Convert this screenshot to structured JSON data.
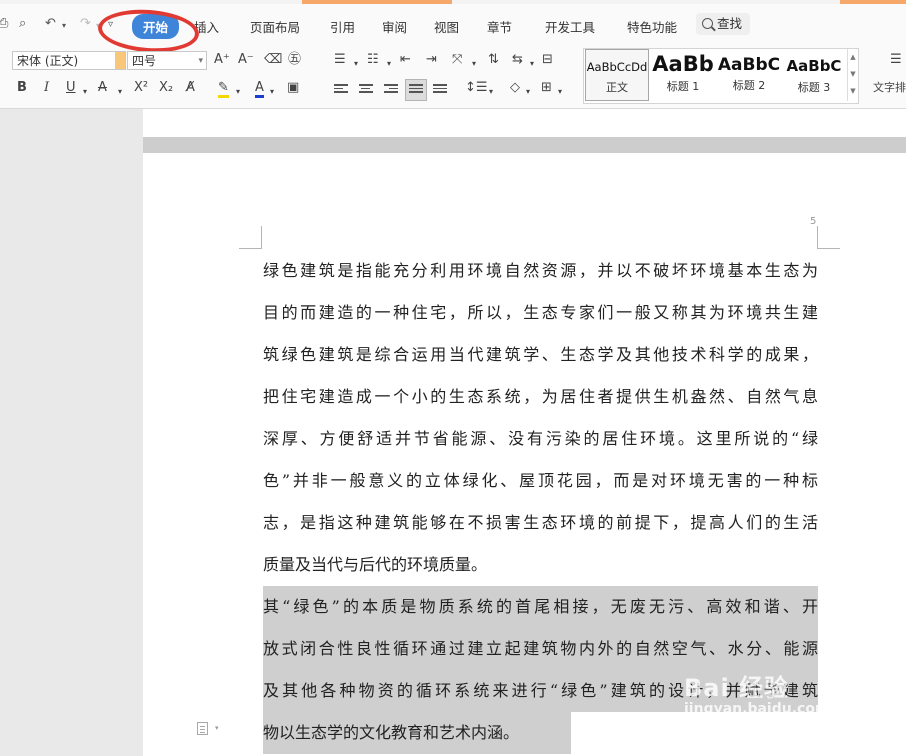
{
  "menubar": {
    "items": [
      "开始",
      "插入",
      "页面布局",
      "引用",
      "审阅",
      "视图",
      "章节",
      "开发工具",
      "特色功能"
    ],
    "active": "开始",
    "search_label": "查找"
  },
  "font": {
    "family_value": "宋体 (正文)",
    "size_value": "四号"
  },
  "styles": [
    {
      "sample": "AaBbCcDd",
      "label": "正文"
    },
    {
      "sample": "AaBb",
      "label": "标题 1"
    },
    {
      "sample": "AaBbC",
      "label": "标题 2"
    },
    {
      "sample": "AaBbC",
      "label": "标题 3"
    }
  ],
  "toolbar_extra_label": "文字排",
  "document": {
    "page_number": "5",
    "paragraphs": [
      {
        "highlighted": false,
        "lines": [
          "绿色建筑是指能充分利用环境自然资源，并以不破坏环境基本生态为",
          "目的而建造的一种住宅，所以，生态专家们一般又称其为环境共生建",
          "筑绿色建筑是综合运用当代建筑学、生态学及其他技术科学的成果，",
          "把住宅建造成一个小的生态系统，为居住者提供生机盎然、自然气息",
          "深厚、方便舒适并节省能源、没有污染的居住环境。这里所说的“绿",
          "色”并非一般意义的立体绿化、屋顶花园，而是对环境无害的一种标",
          "志，是指这种建筑能够在不损害生态环境的前提下，提高人们的生活",
          "质量及当代与后代的环境质量。"
        ]
      },
      {
        "highlighted": true,
        "lines": [
          "其“绿色”的本质是物质系统的首尾相接，无废无污、高效和谐、开",
          "放式闭合性良性循环通过建立起建筑物内外的自然空气、水分、能源",
          "及其他各种物资的循环系统来进行“绿色”建筑的设计，并赋予建筑",
          "物以生态学的文化教育和艺术内涵。"
        ]
      }
    ]
  },
  "watermark": {
    "text": "Bai 经验",
    "url": "jingyan.baidu.com"
  },
  "colors": {
    "active_tab": "#3e84d8",
    "annotation_circle": "#e13a33",
    "highlight": "#cfcfcf",
    "font_color_bar": "#d9342b",
    "highlight_pen": "#f5d800",
    "text_color_bar": "#1a3ecf"
  }
}
